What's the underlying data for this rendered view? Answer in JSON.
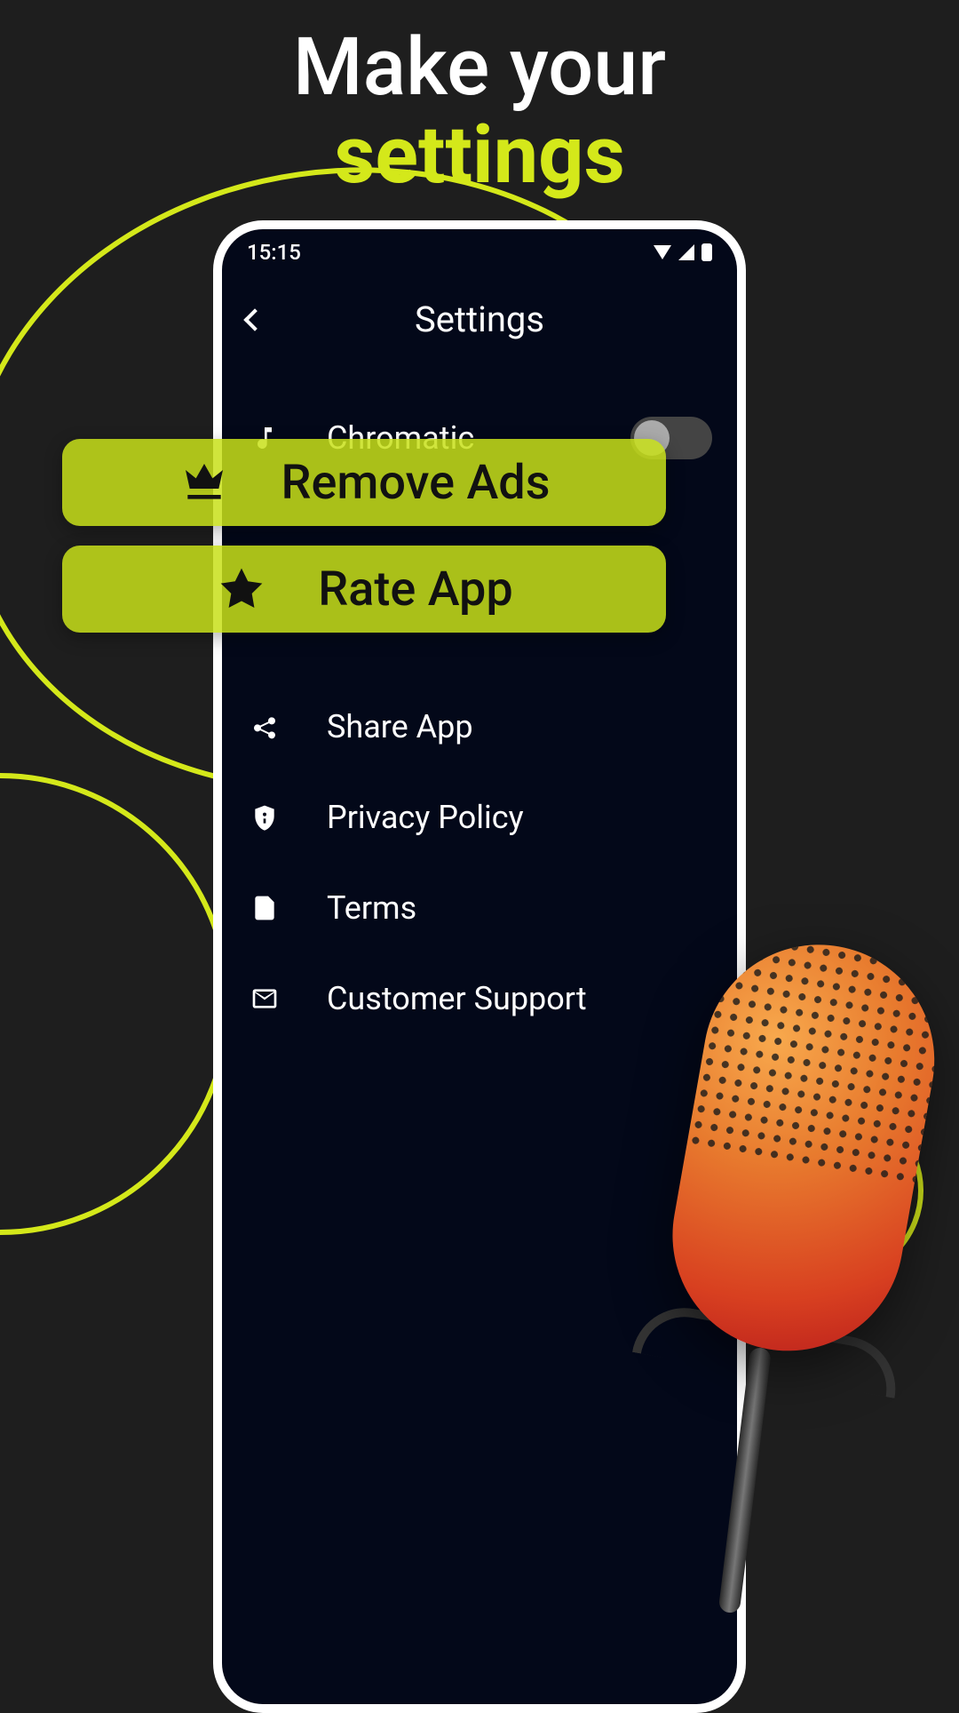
{
  "headline": {
    "line1": "Make your",
    "line2": "settings"
  },
  "statusBar": {
    "time": "15:15"
  },
  "header": {
    "title": "Settings"
  },
  "settings": {
    "chromatic": {
      "label": "Chromatic"
    },
    "share": {
      "label": "Share App"
    },
    "privacy": {
      "label": "Privacy Policy"
    },
    "terms": {
      "label": "Terms"
    },
    "support": {
      "label": "Customer Support"
    }
  },
  "highlights": {
    "removeAds": {
      "label": "Remove Ads"
    },
    "rateApp": {
      "label": "Rate App"
    }
  }
}
